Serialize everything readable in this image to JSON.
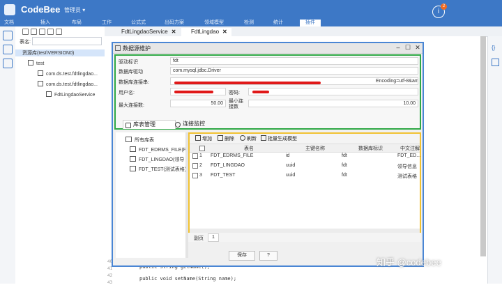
{
  "app": {
    "name": "CodeBee",
    "user": "管理员 ▾",
    "alert_count": "2"
  },
  "menu": [
    "文档",
    "插入",
    "布局",
    "工作",
    "公式式",
    "出码方案",
    "领域模型",
    "检测",
    "统计",
    "插件"
  ],
  "tree": {
    "search_label": "表名:",
    "nodes": [
      "资源库(test\\VERSION0)",
      "test",
      "com.ds.test.fdtlingdao...",
      "com.ds.test.fdtlingdao...",
      "FdtLingdaoService"
    ]
  },
  "tabs": [
    {
      "label": "FdtLingdaoService"
    },
    {
      "label": "FdtLingdao"
    }
  ],
  "code": {
    "lines": [
      "public String getName();",
      "public void setName(String  name);"
    ],
    "line_numbers": [
      "40",
      "41",
      "42",
      "43"
    ]
  },
  "dialog": {
    "title": "数据源维护",
    "form": {
      "id_label": "驱动标识",
      "id_value": "fdt",
      "driver_label": "数据库驱动",
      "driver_value": "com.mysql.jdbc.Driver",
      "url_label": "数据库连接串:",
      "url_tail": "Encoding=utf-8&am...",
      "user_label": "用户名:",
      "pwd_label": "密码:",
      "max_label": "最大连接数:",
      "max_value": "50.00",
      "min_label": "最小连接数",
      "min_value": "10.00"
    },
    "subtabs": [
      "库表管理",
      "连接监控"
    ],
    "tables_tree": {
      "root": "所有库表",
      "items": [
        "FDT_EDRMS_FILE(FC",
        "FDT_LINGDAO(领导",
        "FDT_TEST(测试表格)"
      ]
    },
    "grid": {
      "toolbar": [
        "增加",
        "删除",
        "刷新",
        "批量生成模型"
      ],
      "columns": [
        "表名",
        "主键名称",
        "数据库标识",
        "中文注解"
      ],
      "rows": [
        {
          "n": "1",
          "name": "FDT_EDRMS_FILE",
          "pk": "id",
          "db": "fdt",
          "note": "FDT_ED..."
        },
        {
          "n": "2",
          "name": "FDT_LINGDAO",
          "pk": "uuid",
          "db": "fdt",
          "note": "领导信息"
        },
        {
          "n": "3",
          "name": "FDT_TEST",
          "pk": "uuid",
          "db": "fdt",
          "note": "测试表格"
        }
      ],
      "pager_label": "副页",
      "page": "1"
    },
    "save_label": "保存",
    "help_label": "?"
  },
  "watermark": "知乎 @codebee",
  "colors": {
    "brand": "#3d78c6",
    "form_outline": "#2fa845",
    "grid_outline": "#f1c232",
    "dialog_outline": "#4a86d4",
    "redaction": "#e01818"
  }
}
